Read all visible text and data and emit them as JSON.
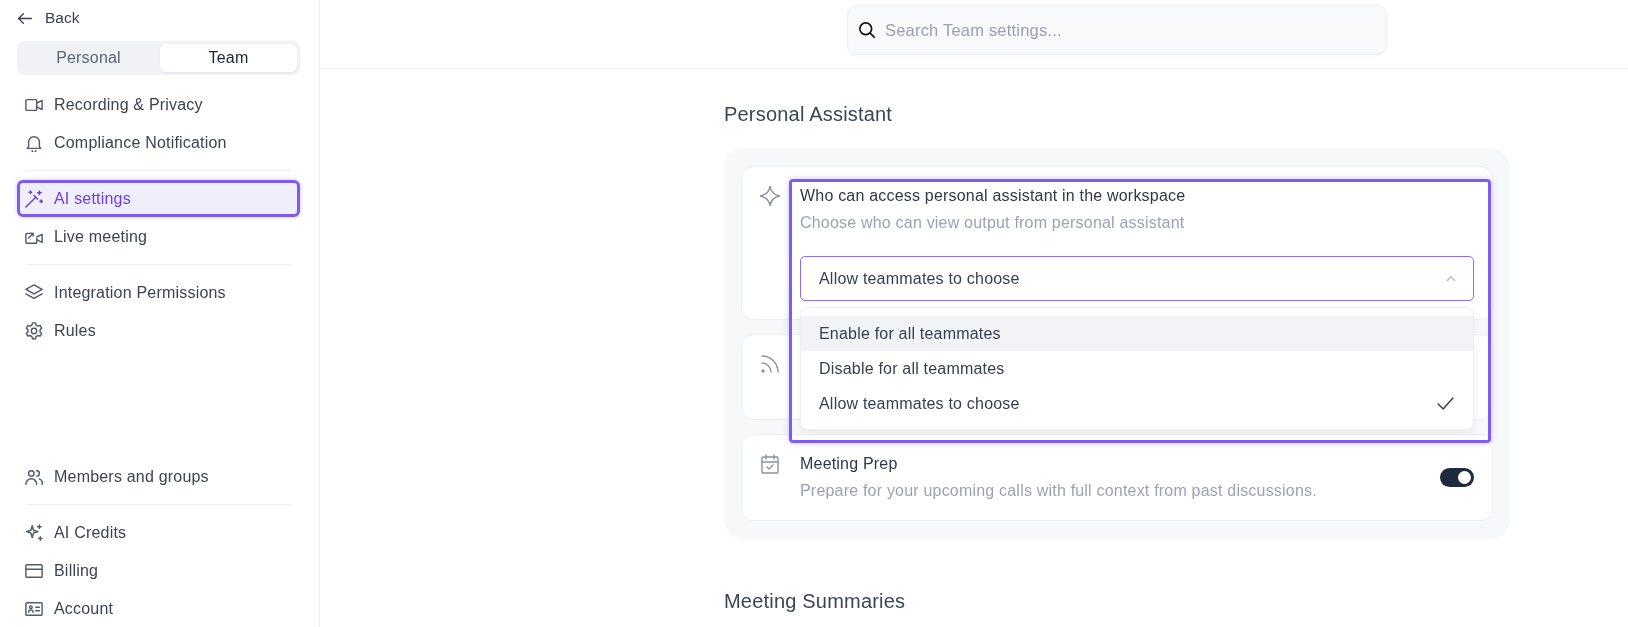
{
  "sidebar": {
    "back": "Back",
    "tabs": [
      {
        "label": "Personal",
        "selected": false
      },
      {
        "label": "Team",
        "selected": true
      }
    ],
    "groups": [
      {
        "items": [
          {
            "label": "Recording & Privacy",
            "selected": false
          },
          {
            "label": "Compliance Notification",
            "selected": false
          }
        ]
      },
      {
        "items": [
          {
            "label": "AI settings",
            "selected": true
          },
          {
            "label": "Live meeting",
            "selected": false
          }
        ]
      },
      {
        "items": [
          {
            "label": "Integration Permissions",
            "selected": false
          },
          {
            "label": "Rules",
            "selected": false
          }
        ]
      }
    ],
    "bottom_groups": [
      {
        "items": [
          {
            "label": "Members and groups",
            "selected": false
          }
        ]
      },
      {
        "items": [
          {
            "label": "AI Credits",
            "selected": false
          },
          {
            "label": "Billing",
            "selected": false
          },
          {
            "label": "Account",
            "selected": false
          }
        ]
      }
    ]
  },
  "search": {
    "placeholder": "Search Team settings..."
  },
  "sections": [
    {
      "title": "Personal Assistant",
      "settings": [
        {
          "kind": "select",
          "title": "Who can access personal assistant in the workspace",
          "description": "Choose who can view output from personal assistant",
          "highlighted": true,
          "select": {
            "value": "Allow teammates to choose",
            "expanded": true,
            "options": [
              {
                "label": "Enable for all teammates",
                "selected": false,
                "hovered": true
              },
              {
                "label": "Disable for all teammates",
                "selected": false,
                "hovered": false
              },
              {
                "label": "Allow teammates to choose",
                "selected": true,
                "hovered": false
              }
            ]
          }
        },
        {
          "kind": "blank"
        },
        {
          "kind": "toggle",
          "title": "Meeting Prep",
          "description": "Prepare for your upcoming calls with full context from past discussions.",
          "on": true
        }
      ]
    },
    {
      "title": "Meeting Summaries"
    }
  ]
}
